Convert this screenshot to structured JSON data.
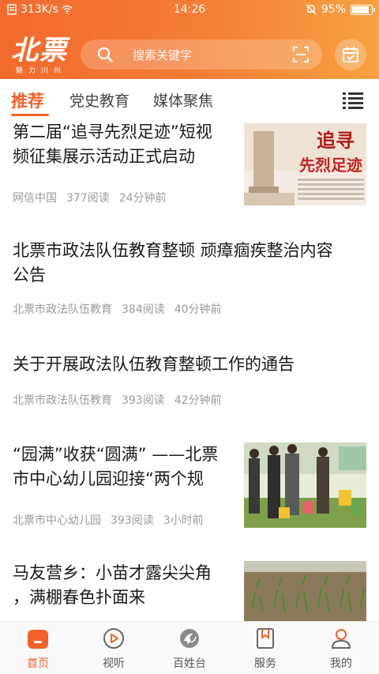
{
  "status_bar": {
    "network_speed": "313K/s",
    "time": "14:26",
    "battery": "95%",
    "battery_level": 0.95
  },
  "header": {
    "logo_main": "北票",
    "logo_sub": "魅力川州",
    "search_placeholder": "搜索关键字"
  },
  "tabs": [
    {
      "label": "推荐",
      "active": true
    },
    {
      "label": "党史教育",
      "active": false
    },
    {
      "label": "媒体聚焦",
      "active": false
    }
  ],
  "feed": [
    {
      "title_lines": [
        "第二届“追寻先烈足迹”短视",
        "频征集展示活动正式启动"
      ],
      "source": "网信中国",
      "reads": "377阅读",
      "time": "24分钟前",
      "thumb_text_1": "追寻",
      "thumb_text_2": "先烈足迹",
      "has_thumb": true
    },
    {
      "title_lines": [
        "北票市政法队伍教育整顿 顽瘴痼疾整治内容",
        "公告"
      ],
      "source": "北票市政法队伍教育",
      "reads": "384阅读",
      "time": "40分钟前",
      "has_thumb": false
    },
    {
      "title_lines": [
        "关于开展政法队伍教育整顿工作的通告"
      ],
      "source": "北票市政法队伍教育",
      "reads": "393阅读",
      "time": "42分钟前",
      "has_thumb": false
    },
    {
      "title_lines": [
        "“园满”收获“圆满” ——北票",
        "市中心幼儿园迎接“两个规"
      ],
      "source": "北票市中心幼儿园",
      "reads": "393阅读",
      "time": "3小时前",
      "has_thumb": true
    },
    {
      "title_lines": [
        "马友营乡：小苗才露尖尖角",
        "，满棚春色扑面来"
      ],
      "has_thumb": true
    }
  ],
  "bottom_nav": [
    {
      "label": "首页",
      "active": true
    },
    {
      "label": "视听",
      "active": false
    },
    {
      "label": "百姓台",
      "active": false
    },
    {
      "label": "服务",
      "active": false
    },
    {
      "label": "我的",
      "active": false
    }
  ],
  "colors": {
    "accent": "#f2622b",
    "header_start": "#f26a2e",
    "header_end": "#f6a142"
  }
}
